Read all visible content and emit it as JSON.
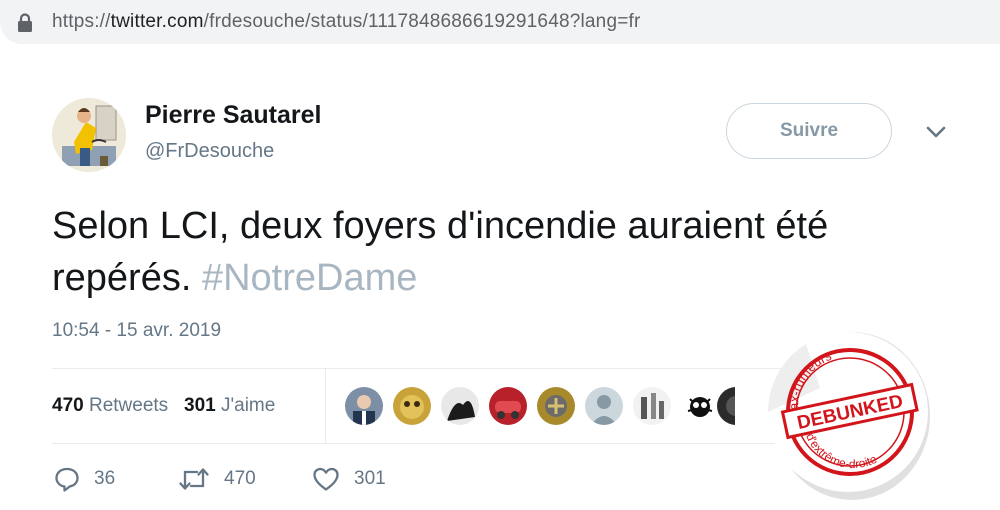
{
  "browser": {
    "url_prefix": "https://",
    "url_main": "twitter.com",
    "url_rest": "/frdesouche/status/1117848686619291648?lang=fr"
  },
  "tweet": {
    "author_name": "Pierre Sautarel",
    "author_handle": "@FrDesouche",
    "follow_label": "Suivre",
    "text": "Selon LCI, deux foyers d'incendie auraient été repérés.",
    "hashtag": "#NotreDame",
    "timestamp": "10:54 - 15 avr. 2019",
    "retweets_count": "470",
    "retweets_label": "Retweets",
    "likes_count": "301",
    "likes_label": "J'aime",
    "reply_count": "36",
    "retweet_action_count": "470",
    "like_action_count": "301"
  },
  "stamp": {
    "top_text": "Hoax-rumeurs",
    "center_text": "DEBUNKED",
    "bottom_text": "d'extrême-droite",
    "color": "#d2151b"
  },
  "colors": {
    "text_primary": "#14171a",
    "text_secondary": "#657786",
    "hashtag": "#a8b6c2",
    "border": "#e6ecf0"
  }
}
